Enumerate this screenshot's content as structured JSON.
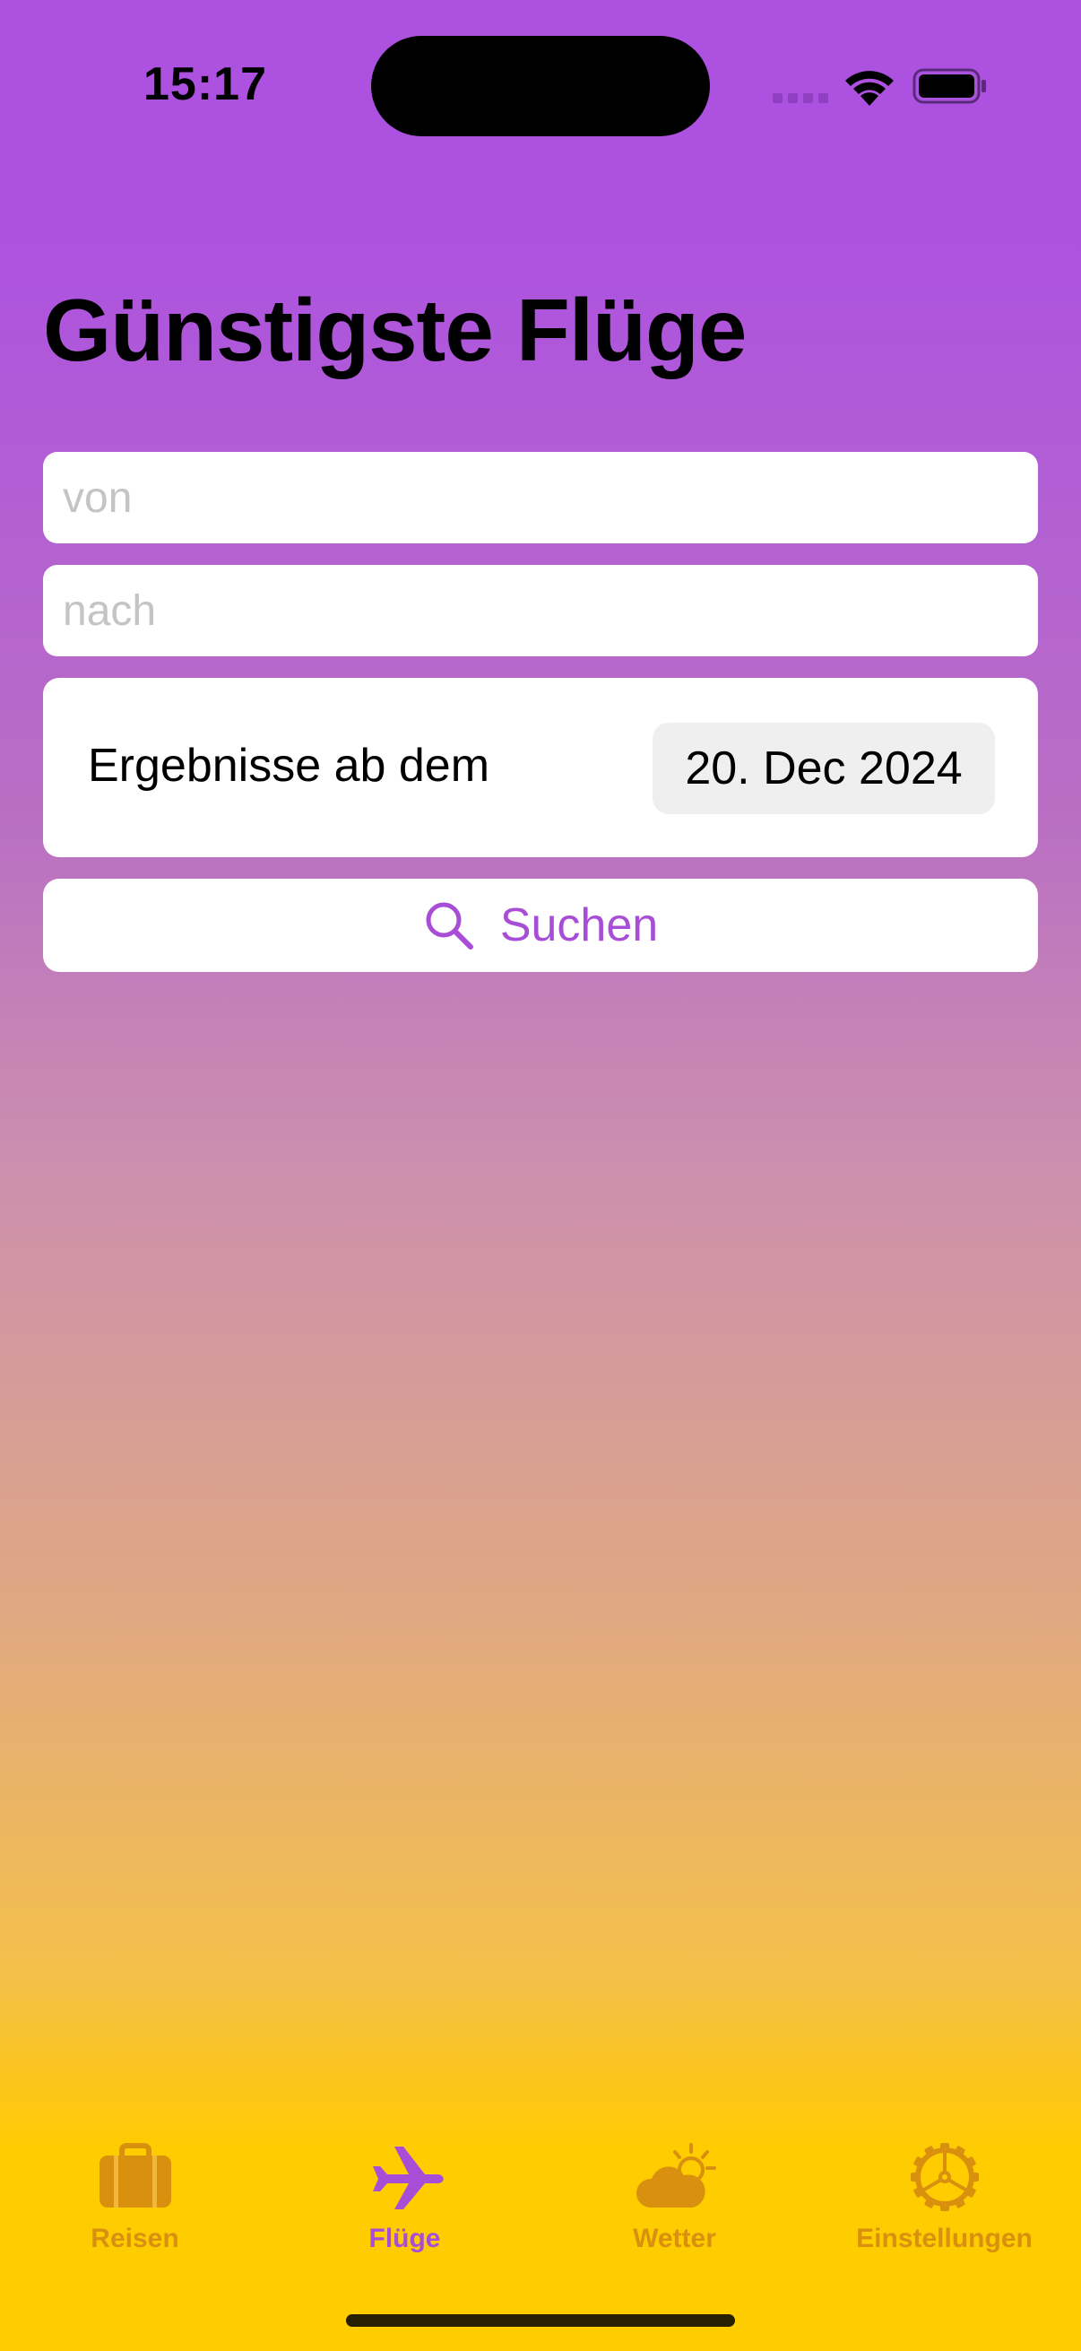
{
  "status_bar": {
    "time": "15:17"
  },
  "page": {
    "title": "Günstigste Flüge"
  },
  "form": {
    "from_placeholder": "von",
    "from_value": "",
    "to_placeholder": "nach",
    "to_value": "",
    "date_label": "Ergebnisse ab dem",
    "date_value": "20. Dec 2024",
    "search_label": "Suchen"
  },
  "tabs": [
    {
      "label": "Reisen",
      "icon": "suitcase-icon",
      "active": false
    },
    {
      "label": "Flüge",
      "icon": "airplane-icon",
      "active": true
    },
    {
      "label": "Wetter",
      "icon": "cloud-sun-icon",
      "active": false
    },
    {
      "label": "Einstellungen",
      "icon": "gear-icon",
      "active": false
    }
  ],
  "colors": {
    "accent": "#a84ed6",
    "inactive_tab": "#d9900f",
    "gradient_top": "#ad52e0",
    "gradient_bottom": "#ffcc00"
  }
}
